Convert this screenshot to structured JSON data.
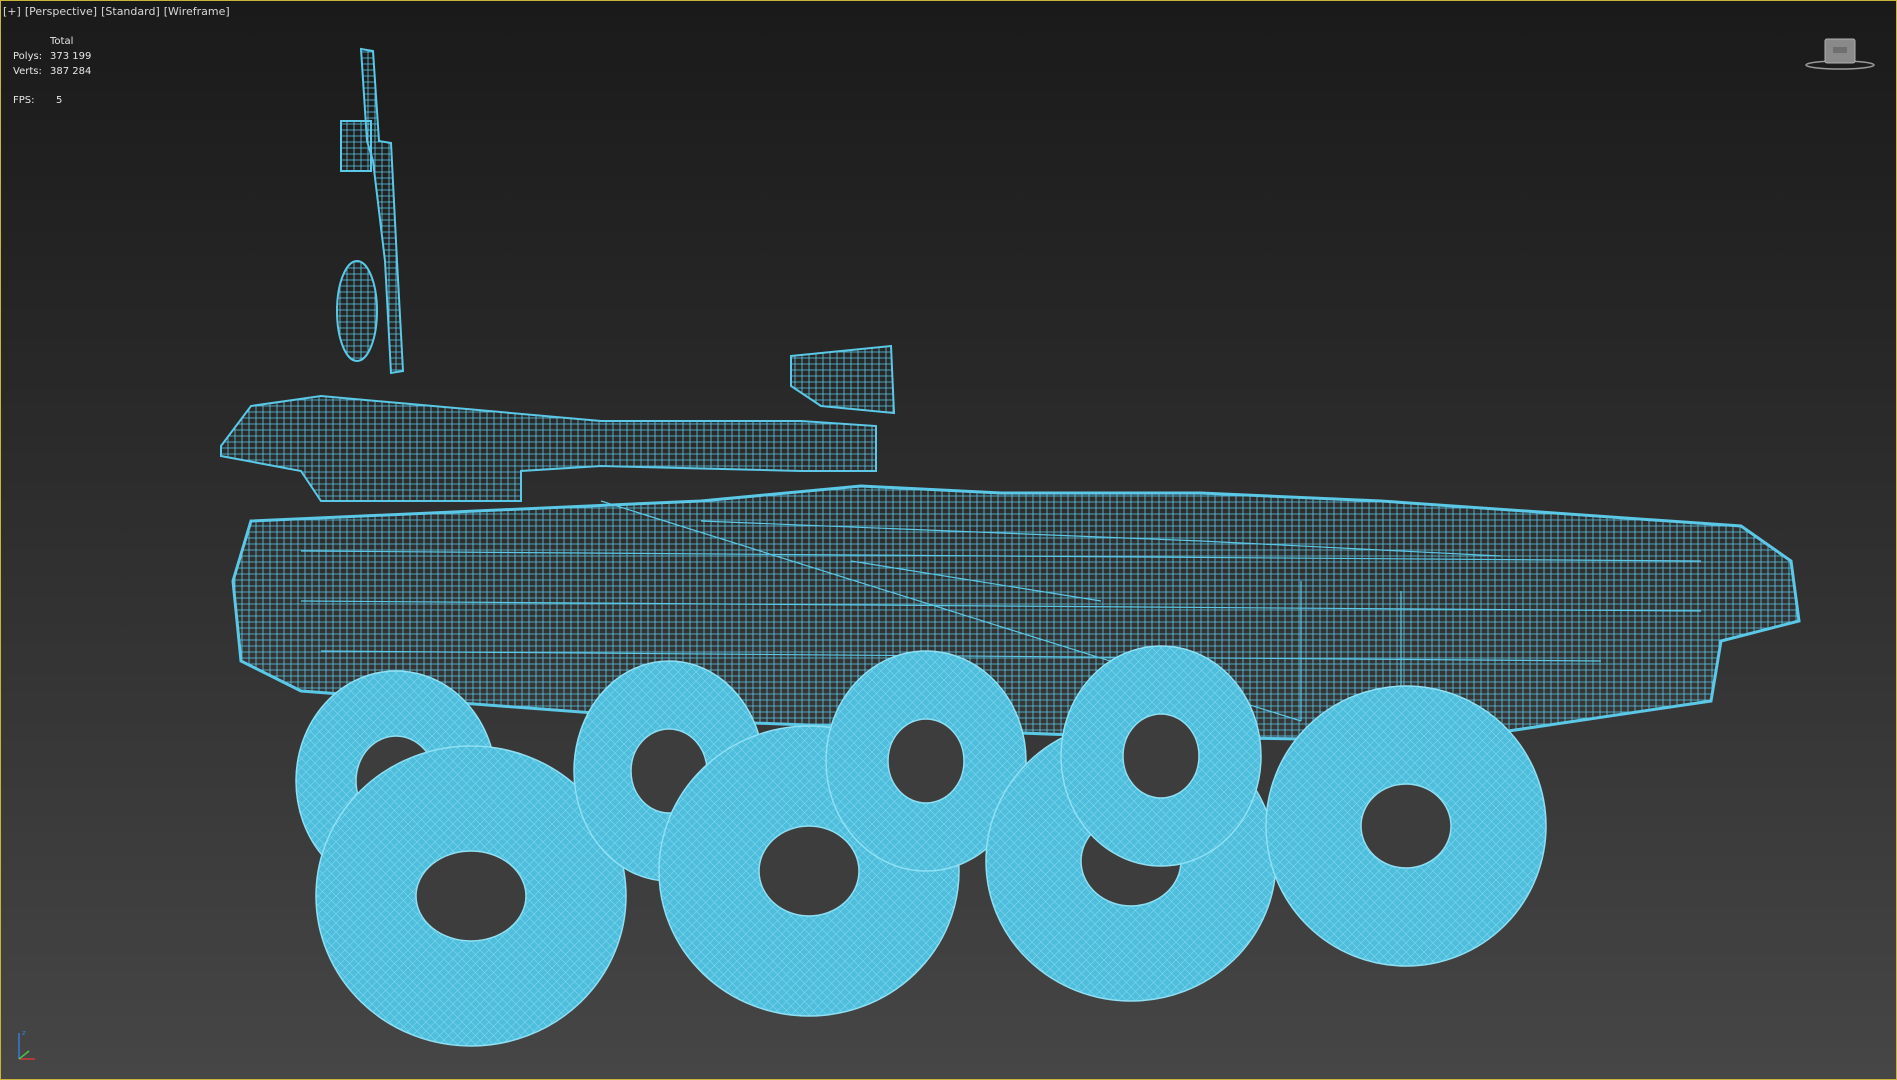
{
  "viewport": {
    "labels": [
      "[+]",
      "[Perspective]",
      "[Standard]",
      "[Wireframe]"
    ]
  },
  "stats": {
    "header": "Total",
    "polys_label": "Polys:",
    "polys_value": "373 199",
    "verts_label": "Verts:",
    "verts_value": "387 284",
    "fps_label": "FPS:",
    "fps_value": "5"
  },
  "colors": {
    "wireframe": "#5ac8e6",
    "frame_border": "#c9b43a",
    "text": "#e6e6e6"
  },
  "icons": [
    "viewcube-icon",
    "axis-gizmo-icon"
  ]
}
